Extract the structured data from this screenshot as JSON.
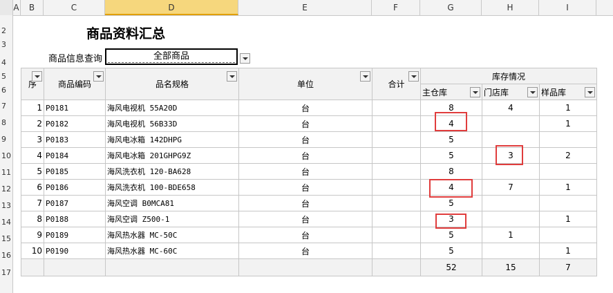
{
  "columns": [
    "A",
    "B",
    "C",
    "D",
    "E",
    "F",
    "G",
    "H",
    "I"
  ],
  "rows": [
    "2",
    "3",
    "4",
    "5",
    "6",
    "7",
    "8",
    "9",
    "10",
    "11",
    "12",
    "13",
    "14",
    "15",
    "16",
    "17"
  ],
  "title": "商品资料汇总",
  "query": {
    "label": "商品信息查询",
    "value": "全部商品"
  },
  "stock_group_header": "库存情况",
  "headers": {
    "seq": "序",
    "code": "商品编码",
    "name": "品名规格",
    "unit": "单位",
    "total": "合计",
    "main": "主仓库",
    "store": "门店库",
    "sample": "样品库"
  },
  "items": [
    {
      "seq": "1",
      "code": "P0181",
      "name": "海风电视机 55A20D",
      "unit": "台",
      "total": "",
      "main": "8",
      "store": "4",
      "sample": "1"
    },
    {
      "seq": "2",
      "code": "P0182",
      "name": "海风电视机 56B33D",
      "unit": "台",
      "total": "",
      "main": "4",
      "store": "",
      "sample": "1"
    },
    {
      "seq": "3",
      "code": "P0183",
      "name": "海风电冰箱 142DHPG",
      "unit": "台",
      "total": "",
      "main": "5",
      "store": "",
      "sample": ""
    },
    {
      "seq": "4",
      "code": "P0184",
      "name": "海风电冰箱 201GHPG9Z",
      "unit": "台",
      "total": "",
      "main": "5",
      "store": "3",
      "sample": "2"
    },
    {
      "seq": "5",
      "code": "P0185",
      "name": "海风洗衣机 120-BA628",
      "unit": "台",
      "total": "",
      "main": "8",
      "store": "",
      "sample": ""
    },
    {
      "seq": "6",
      "code": "P0186",
      "name": "海风洗衣机 100-BDE658",
      "unit": "台",
      "total": "",
      "main": "4",
      "store": "7",
      "sample": "1"
    },
    {
      "seq": "7",
      "code": "P0187",
      "name": "海风空调 B0MCA81",
      "unit": "台",
      "total": "",
      "main": "5",
      "store": "",
      "sample": ""
    },
    {
      "seq": "8",
      "code": "P0188",
      "name": "海风空调 Z500-1",
      "unit": "台",
      "total": "",
      "main": "3",
      "store": "",
      "sample": "1"
    },
    {
      "seq": "9",
      "code": "P0189",
      "name": "海风热水器 MC-50C",
      "unit": "台",
      "total": "",
      "main": "5",
      "store": "1",
      "sample": ""
    },
    {
      "seq": "10",
      "code": "P0190",
      "name": "海风热水器 MC-60C",
      "unit": "台",
      "total": "",
      "main": "5",
      "store": "",
      "sample": "1"
    }
  ],
  "totals": {
    "main": "52",
    "store": "15",
    "sample": "7"
  }
}
